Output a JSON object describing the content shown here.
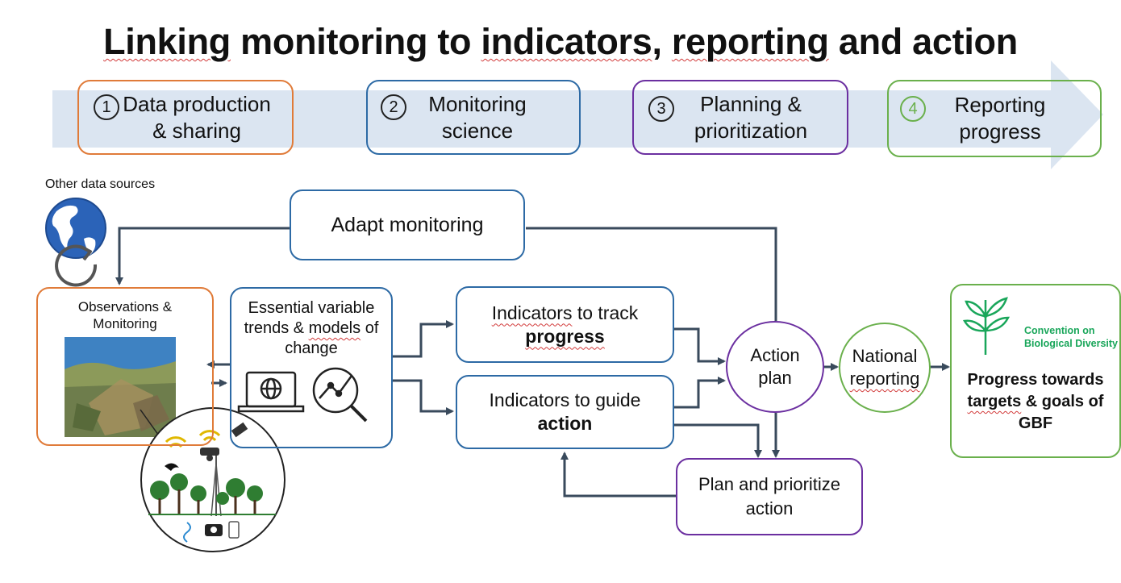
{
  "title": {
    "part1": "Linking",
    "part2": " monitoring to ",
    "part3": "indicators",
    "part4": ", ",
    "part5": "reporting",
    "part6": " and action"
  },
  "stages": [
    {
      "number": "1",
      "line1": "Data production",
      "line2": "& sharing",
      "color": "#e07b39"
    },
    {
      "number": "2",
      "line1": "Monitoring",
      "line2": "science",
      "color": "#2d6aa5"
    },
    {
      "number": "3",
      "line1": "Planning &",
      "line2": "prioritization",
      "color": "#6b2fa0"
    },
    {
      "number": "4",
      "line1": "Reporting",
      "line2": "progress",
      "color": "#6ab04c"
    }
  ],
  "other_sources": "Other data sources",
  "observations": {
    "line1": "Observations &",
    "line2": "Monitoring"
  },
  "adapt": "Adapt monitoring",
  "essential": {
    "line1": "Essential variable",
    "line2a": "trends & ",
    "line2b": "models",
    "line2c": " of",
    "line3": "change"
  },
  "track": {
    "line1a": "Indicators",
    "line1b": " to track",
    "line2": "progress"
  },
  "guide": {
    "line1": "Indicators to guide",
    "line2": "action"
  },
  "action_plan": {
    "line1": "Action",
    "line2": "plan"
  },
  "national": {
    "line1": "National",
    "line2": "reporting"
  },
  "plan_prioritize": {
    "line1": "Plan and prioritize",
    "line2": "action"
  },
  "cbd": {
    "logo_line1": "Convention on",
    "logo_line2": "Biological Diversity",
    "text1": "Progress towards",
    "text2a": "targets",
    "text2b": " & goals of",
    "text3": "GBF"
  },
  "colors": {
    "orange": "#e07b39",
    "blue": "#2d6aa5",
    "purple": "#6b2fa0",
    "green": "#6ab04c",
    "arrow": "#394a5c",
    "band": "#dbe5f1"
  }
}
